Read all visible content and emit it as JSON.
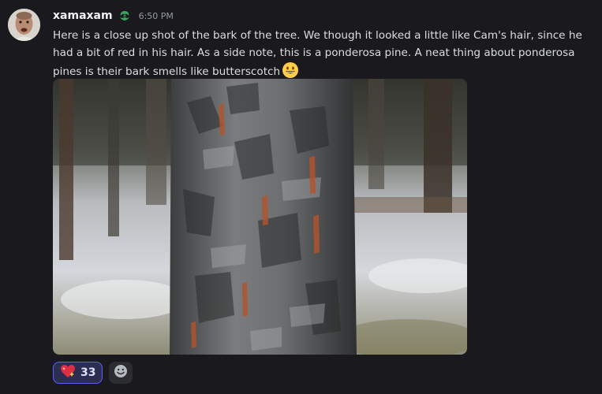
{
  "message": {
    "author": "xamaxam",
    "timestamp": "6:50 PM",
    "text": "Here is a close up shot of the bark of the tree. We though it looked a little like Cam's hair, since he had a bit of red in his hair. As a side note, this is a ponderosa pine. A neat thing about ponderosa pines is their bark smells like butterscotch",
    "trailing_emoji": "grinning-face-emoji",
    "author_badge": "leaf-badge-icon",
    "attachment": {
      "subject": "tree-bark-photo"
    }
  },
  "reactions": [
    {
      "emoji": "sparkling-heart-icon",
      "count": "33",
      "active": true
    }
  ],
  "add_reaction_icon": "smiley-add-reaction-icon",
  "colors": {
    "background": "#1a1a1e",
    "text": "#dbdee1",
    "username": "#f2f3f5",
    "timestamp": "#949ba4",
    "reaction_active_bg": "#2b2d52",
    "reaction_active_border": "#5865f2",
    "badge_green": "#3ba55d"
  }
}
